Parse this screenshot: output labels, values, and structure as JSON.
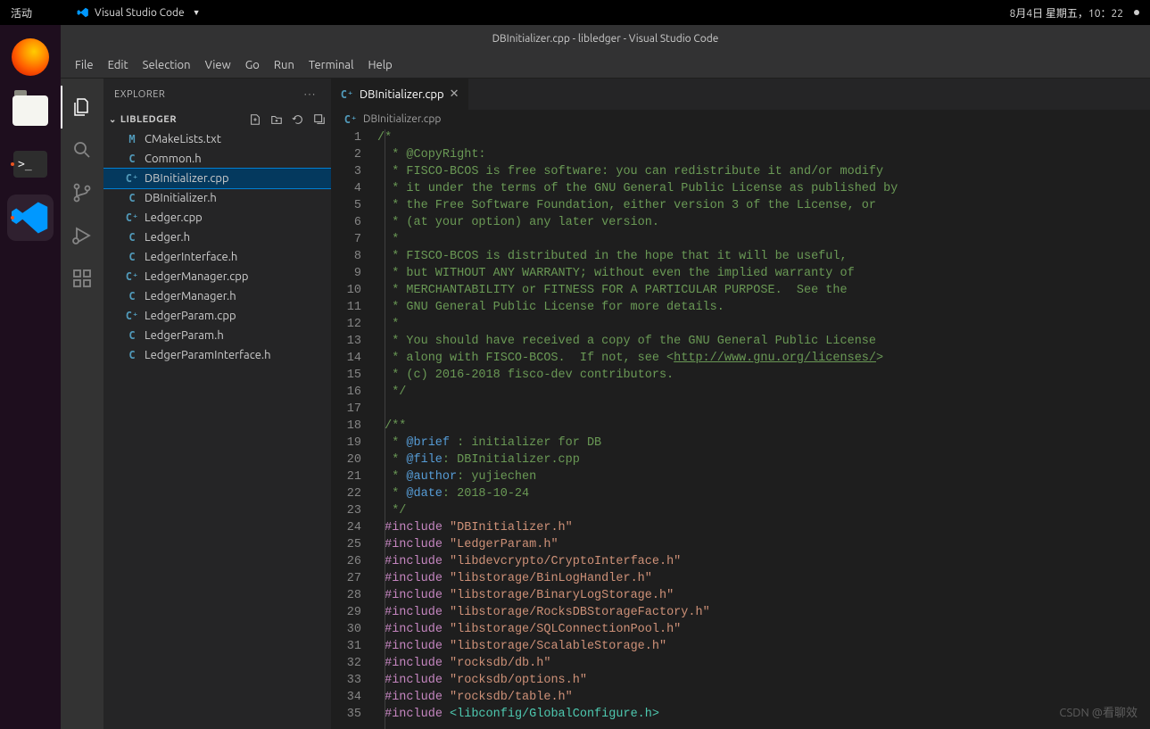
{
  "gnome": {
    "activities_label": "活动",
    "app_menu_label": "Visual Studio Code",
    "datetime": "8月4日 星期五，10：22"
  },
  "launcher": {
    "firefox": "firefox",
    "files": "files",
    "terminal": "terminal-prompt",
    "vscode": "vscode"
  },
  "window_title": "DBInitializer.cpp - libledger - Visual Studio Code",
  "menubar": [
    "File",
    "Edit",
    "Selection",
    "View",
    "Go",
    "Run",
    "Terminal",
    "Help"
  ],
  "explorer": {
    "title": "EXPLORER",
    "folder": "LIBLEDGER",
    "files": [
      {
        "icon": "M",
        "cls": "ic-m",
        "name": "CMakeLists.txt"
      },
      {
        "icon": "C",
        "cls": "ic-c",
        "name": "Common.h"
      },
      {
        "icon": "C⁺",
        "cls": "ic-cpp",
        "name": "DBInitializer.cpp",
        "selected": true
      },
      {
        "icon": "C",
        "cls": "ic-c",
        "name": "DBInitializer.h"
      },
      {
        "icon": "C⁺",
        "cls": "ic-cpp",
        "name": "Ledger.cpp"
      },
      {
        "icon": "C",
        "cls": "ic-c",
        "name": "Ledger.h"
      },
      {
        "icon": "C",
        "cls": "ic-c",
        "name": "LedgerInterface.h"
      },
      {
        "icon": "C⁺",
        "cls": "ic-cpp",
        "name": "LedgerManager.cpp"
      },
      {
        "icon": "C",
        "cls": "ic-c",
        "name": "LedgerManager.h"
      },
      {
        "icon": "C⁺",
        "cls": "ic-cpp",
        "name": "LedgerParam.cpp"
      },
      {
        "icon": "C",
        "cls": "ic-c",
        "name": "LedgerParam.h"
      },
      {
        "icon": "C",
        "cls": "ic-c",
        "name": "LedgerParamInterface.h"
      }
    ]
  },
  "tab": {
    "icon": "C⁺",
    "label": "DBInitializer.cpp"
  },
  "breadcrumb": {
    "icon": "C⁺",
    "label": "DBInitializer.cpp"
  },
  "code": {
    "license_url": "http://www.gnu.org/licenses/",
    "lines": [
      {
        "n": 1,
        "html": "<span class='c-comment'>/*</span>"
      },
      {
        "n": 2,
        "html": "  <span class='c-comment'>* @CopyRight:</span>"
      },
      {
        "n": 3,
        "html": "  <span class='c-comment'>* FISCO-BCOS is free software: you can redistribute it and/or modify</span>"
      },
      {
        "n": 4,
        "html": "  <span class='c-comment'>* it under the terms of the GNU General Public License as published by</span>"
      },
      {
        "n": 5,
        "html": "  <span class='c-comment'>* the Free Software Foundation, either version 3 of the License, or</span>"
      },
      {
        "n": 6,
        "html": "  <span class='c-comment'>* (at your option) any later version.</span>"
      },
      {
        "n": 7,
        "html": "  <span class='c-comment'>*</span>"
      },
      {
        "n": 8,
        "html": "  <span class='c-comment'>* FISCO-BCOS is distributed in the hope that it will be useful,</span>"
      },
      {
        "n": 9,
        "html": "  <span class='c-comment'>* but WITHOUT ANY WARRANTY; without even the implied warranty of</span>"
      },
      {
        "n": 10,
        "html": "  <span class='c-comment'>* MERCHANTABILITY or FITNESS FOR A PARTICULAR PURPOSE.  See the</span>"
      },
      {
        "n": 11,
        "html": "  <span class='c-comment'>* GNU General Public License for more details.</span>"
      },
      {
        "n": 12,
        "html": "  <span class='c-comment'>*</span>"
      },
      {
        "n": 13,
        "html": "  <span class='c-comment'>* You should have received a copy of the GNU General Public License</span>"
      },
      {
        "n": 14,
        "html": "  <span class='c-comment'>* along with FISCO-BCOS.  If not, see &lt;<span class='c-link'>http://www.gnu.org/licenses/</span>&gt;</span>"
      },
      {
        "n": 15,
        "html": "  <span class='c-comment'>* (c) 2016-2018 fisco-dev contributors.</span>"
      },
      {
        "n": 16,
        "html": "  <span class='c-comment'>*/</span>"
      },
      {
        "n": 17,
        "html": ""
      },
      {
        "n": 18,
        "html": " <span class='c-comment'>/**</span>"
      },
      {
        "n": 19,
        "html": "  <span class='c-comment'>* <span class='c-doctag'>@brief</span> : initializer for DB</span>"
      },
      {
        "n": 20,
        "html": "  <span class='c-comment'>* <span class='c-doctag'>@file</span>: DBInitializer.cpp</span>"
      },
      {
        "n": 21,
        "html": "  <span class='c-comment'>* <span class='c-doctag'>@author</span>: yujiechen</span>"
      },
      {
        "n": 22,
        "html": "  <span class='c-comment'>* <span class='c-doctag'>@date</span>: 2018-10-24</span>"
      },
      {
        "n": 23,
        "html": "  <span class='c-comment'>*/</span>"
      },
      {
        "n": 24,
        "html": " <span class='c-include'>#include</span> <span class='c-string'>\"DBInitializer.h\"</span>"
      },
      {
        "n": 25,
        "html": " <span class='c-include'>#include</span> <span class='c-string'>\"LedgerParam.h\"</span>"
      },
      {
        "n": 26,
        "html": " <span class='c-include'>#include</span> <span class='c-string'>\"libdevcrypto/CryptoInterface.h\"</span>"
      },
      {
        "n": 27,
        "html": " <span class='c-include'>#include</span> <span class='c-string'>\"libstorage/BinLogHandler.h\"</span>"
      },
      {
        "n": 28,
        "html": " <span class='c-include'>#include</span> <span class='c-string'>\"libstorage/BinaryLogStorage.h\"</span>"
      },
      {
        "n": 29,
        "html": " <span class='c-include'>#include</span> <span class='c-string'>\"libstorage/RocksDBStorageFactory.h\"</span>"
      },
      {
        "n": 30,
        "html": " <span class='c-include'>#include</span> <span class='c-string'>\"libstorage/SQLConnectionPool.h\"</span>"
      },
      {
        "n": 31,
        "html": " <span class='c-include'>#include</span> <span class='c-string'>\"libstorage/ScalableStorage.h\"</span>"
      },
      {
        "n": 32,
        "html": " <span class='c-include'>#include</span> <span class='c-string'>\"rocksdb/db.h\"</span>"
      },
      {
        "n": 33,
        "html": " <span class='c-include'>#include</span> <span class='c-string'>\"rocksdb/options.h\"</span>"
      },
      {
        "n": 34,
        "html": " <span class='c-include'>#include</span> <span class='c-string'>\"rocksdb/table.h\"</span>"
      },
      {
        "n": 35,
        "html": " <span class='c-include'>#include</span> <span class='c-sysinclude'>&lt;libconfig/GlobalConfigure.h&gt;</span>"
      }
    ]
  },
  "watermark": "CSDN @看聊效"
}
